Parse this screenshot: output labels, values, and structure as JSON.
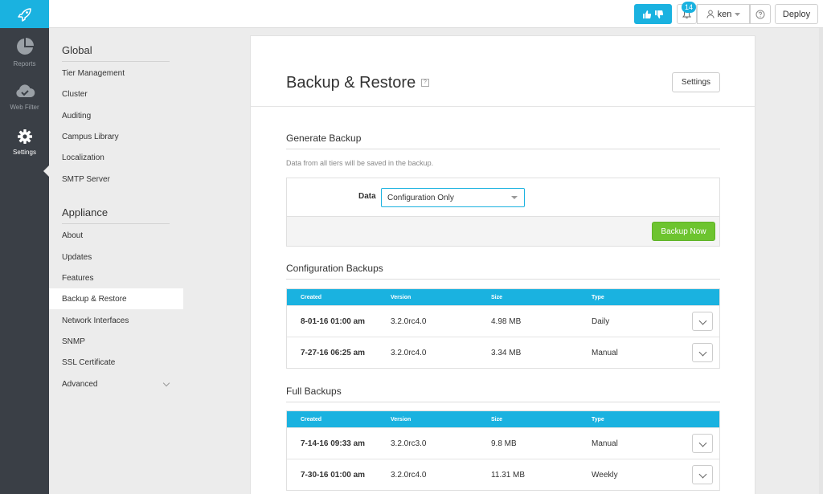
{
  "topbar": {
    "notification_count": "14",
    "user_name": "ken",
    "deploy_label": "Deploy"
  },
  "rail": {
    "items": [
      {
        "label": "Reports",
        "icon": "pie-chart-icon"
      },
      {
        "label": "Web Filter",
        "icon": "cloud-check-icon"
      },
      {
        "label": "Settings",
        "icon": "gear-icon"
      }
    ]
  },
  "nav": {
    "global_heading": "Global",
    "global_items": [
      "Tier Management",
      "Cluster",
      "Auditing",
      "Campus Library",
      "Localization",
      "SMTP Server"
    ],
    "appliance_heading": "Appliance",
    "appliance_items": [
      "About",
      "Updates",
      "Features",
      "Backup & Restore",
      "Network Interfaces",
      "SNMP",
      "SSL Certificate",
      "Advanced"
    ],
    "active_item": "Backup & Restore"
  },
  "page": {
    "title": "Backup & Restore",
    "help_mark": "?",
    "settings_label": "Settings"
  },
  "generate": {
    "heading": "Generate Backup",
    "hint": "Data from all tiers will be saved in the backup.",
    "data_label": "Data",
    "data_value": "Configuration Only",
    "backup_now_label": "Backup Now"
  },
  "columns": [
    "Created",
    "Version",
    "Size",
    "Type"
  ],
  "config_backups": {
    "heading": "Configuration Backups",
    "rows": [
      {
        "created": "8-01-16 01:00 am",
        "version": "3.2.0rc4.0",
        "size": "4.98 MB",
        "type": "Daily"
      },
      {
        "created": "7-27-16 06:25 am",
        "version": "3.2.0rc4.0",
        "size": "3.34 MB",
        "type": "Manual"
      }
    ]
  },
  "full_backups": {
    "heading": "Full Backups",
    "rows": [
      {
        "created": "7-14-16 09:33 am",
        "version": "3.2.0rc3.0",
        "size": "9.8 MB",
        "type": "Manual"
      },
      {
        "created": "7-30-16 01:00 am",
        "version": "3.2.0rc4.0",
        "size": "11.31 MB",
        "type": "Weekly"
      }
    ]
  },
  "colors": {
    "accent": "#1ab2e0",
    "success": "#6dc42f",
    "rail": "#3a3f46"
  }
}
